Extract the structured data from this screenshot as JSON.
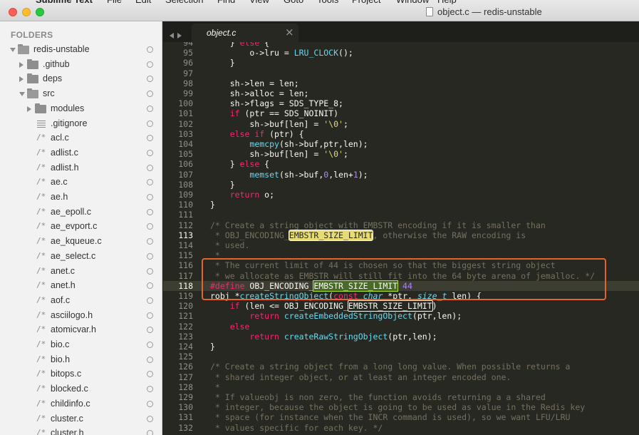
{
  "menubar": [
    "Sublime Text",
    "File",
    "Edit",
    "Selection",
    "Find",
    "View",
    "Goto",
    "Tools",
    "Project",
    "Window",
    "Help"
  ],
  "window": {
    "title": "object.c — redis-unstable"
  },
  "sidebar": {
    "heading": "FOLDERS",
    "items": [
      {
        "label": "redis-unstable",
        "kind": "folder-open",
        "depth": 0
      },
      {
        "label": ".github",
        "kind": "folder",
        "depth": 1
      },
      {
        "label": "deps",
        "kind": "folder",
        "depth": 1
      },
      {
        "label": "src",
        "kind": "folder-open",
        "depth": 1
      },
      {
        "label": "modules",
        "kind": "folder",
        "depth": 2
      },
      {
        "label": ".gitignore",
        "kind": "lines",
        "depth": 2
      },
      {
        "label": "acl.c",
        "kind": "c",
        "depth": 2
      },
      {
        "label": "adlist.c",
        "kind": "c",
        "depth": 2
      },
      {
        "label": "adlist.h",
        "kind": "c",
        "depth": 2
      },
      {
        "label": "ae.c",
        "kind": "c",
        "depth": 2
      },
      {
        "label": "ae.h",
        "kind": "c",
        "depth": 2
      },
      {
        "label": "ae_epoll.c",
        "kind": "c",
        "depth": 2
      },
      {
        "label": "ae_evport.c",
        "kind": "c",
        "depth": 2
      },
      {
        "label": "ae_kqueue.c",
        "kind": "c",
        "depth": 2
      },
      {
        "label": "ae_select.c",
        "kind": "c",
        "depth": 2
      },
      {
        "label": "anet.c",
        "kind": "c",
        "depth": 2
      },
      {
        "label": "anet.h",
        "kind": "c",
        "depth": 2
      },
      {
        "label": "aof.c",
        "kind": "c",
        "depth": 2
      },
      {
        "label": "asciilogo.h",
        "kind": "c",
        "depth": 2
      },
      {
        "label": "atomicvar.h",
        "kind": "c",
        "depth": 2
      },
      {
        "label": "bio.c",
        "kind": "c",
        "depth": 2
      },
      {
        "label": "bio.h",
        "kind": "c",
        "depth": 2
      },
      {
        "label": "bitops.c",
        "kind": "c",
        "depth": 2
      },
      {
        "label": "blocked.c",
        "kind": "c",
        "depth": 2
      },
      {
        "label": "childinfo.c",
        "kind": "c",
        "depth": 2
      },
      {
        "label": "cluster.c",
        "kind": "c",
        "depth": 2
      },
      {
        "label": "cluster.h",
        "kind": "c",
        "depth": 2
      }
    ]
  },
  "tabs": [
    {
      "label": "object.c",
      "close": "×"
    }
  ],
  "editor": {
    "lines": [
      {
        "n": "94",
        "html": "    } <span class='kw'>else</span> {"
      },
      {
        "n": "95",
        "html": "        o->lru = <span class='fn'>LRU_CLOCK</span>();"
      },
      {
        "n": "96",
        "html": "    }"
      },
      {
        "n": "97",
        "html": ""
      },
      {
        "n": "98",
        "html": "    sh->len = len;"
      },
      {
        "n": "99",
        "html": "    sh->alloc = len;"
      },
      {
        "n": "100",
        "html": "    sh->flags = SDS_TYPE_8;"
      },
      {
        "n": "101",
        "html": "    <span class='kw'>if</span> (ptr == SDS_NOINIT)"
      },
      {
        "n": "102",
        "html": "        sh->buf[len] = <span class='str'>'\\0'</span>;"
      },
      {
        "n": "103",
        "html": "    <span class='kw'>else if</span> (ptr) {"
      },
      {
        "n": "104",
        "html": "        <span class='fn'>memcpy</span>(sh->buf,ptr,len);"
      },
      {
        "n": "105",
        "html": "        sh->buf[len] = <span class='str'>'\\0'</span>;"
      },
      {
        "n": "106",
        "html": "    } <span class='kw'>else</span> {"
      },
      {
        "n": "107",
        "html": "        <span class='fn'>memset</span>(sh->buf,<span class='num'>0</span>,len+<span class='num'>1</span>);"
      },
      {
        "n": "108",
        "html": "    }"
      },
      {
        "n": "109",
        "html": "    <span class='kw'>return</span> o;"
      },
      {
        "n": "110",
        "html": "}"
      },
      {
        "n": "111",
        "html": ""
      },
      {
        "n": "112",
        "html": "<span class='cm'>/* Create a string object with EMBSTR encoding if it is smaller than</span>"
      },
      {
        "n": "113",
        "html": "<span class='cm'> * OBJ_ENCODING_</span><span class='hl-yellow hl-box'>EMBSTR_SIZE_LIMIT</span><span class='cm'>, otherwise the RAW encoding is</span>",
        "gutter": true
      },
      {
        "n": "114",
        "html": "<span class='cm'> * used.</span>"
      },
      {
        "n": "115",
        "html": "<span class='cm'> *</span>"
      },
      {
        "n": "116",
        "html": "<span class='cm'> * The current limit of 44 is chosen so that the biggest string object</span>"
      },
      {
        "n": "117",
        "html": "<span class='cm'> * we allocate as EMBSTR will still fit into the 64 byte arena of jemalloc. */</span>"
      },
      {
        "n": "118",
        "html": "<span class='kw'>#define</span> OBJ_ENCODING_<span class='hl-green'>EMBSTR_SIZE_LIMIT</span> <span class='num'>44</span>",
        "current": true,
        "gutter": true
      },
      {
        "n": "119",
        "html": "robj *<span class='fn'>createStringObject</span>(<span class='kw'>const</span> <span class='typ'>char</span> *ptr, <span class='typ'>size_t</span> len) {"
      },
      {
        "n": "120",
        "html": "    <span class='kw'>if</span> (len <= OBJ_ENCODING_<span class='hl-outline'>EMBSTR_SIZE_LIMIT</span>)"
      },
      {
        "n": "121",
        "html": "        <span class='kw'>return</span> <span class='fn'>createEmbeddedStringObject</span>(ptr,len);"
      },
      {
        "n": "122",
        "html": "    <span class='kw'>else</span>"
      },
      {
        "n": "123",
        "html": "        <span class='kw'>return</span> <span class='fn'>createRawStringObject</span>(ptr,len);"
      },
      {
        "n": "124",
        "html": "}"
      },
      {
        "n": "125",
        "html": ""
      },
      {
        "n": "126",
        "html": "<span class='cm'>/* Create a string object from a long long value. When possible returns a</span>"
      },
      {
        "n": "127",
        "html": "<span class='cm'> * shared integer object, or at least an integer encoded one.</span>"
      },
      {
        "n": "128",
        "html": "<span class='cm'> *</span>"
      },
      {
        "n": "129",
        "html": "<span class='cm'> * If valueobj is non zero, the function avoids returning a a shared</span>"
      },
      {
        "n": "130",
        "html": "<span class='cm'> * integer, because the object is going to be used as value in the Redis key</span>"
      },
      {
        "n": "131",
        "html": "<span class='cm'> * space (for instance when the INCR command is used), so we want LFU/LRU</span>"
      },
      {
        "n": "132",
        "html": "<span class='cm'> * values specific for each key. */</span>"
      }
    ]
  },
  "colors": {
    "annotation": "#e8622a",
    "editor_bg": "#272822",
    "sidebar_bg": "#f2f2f2"
  }
}
